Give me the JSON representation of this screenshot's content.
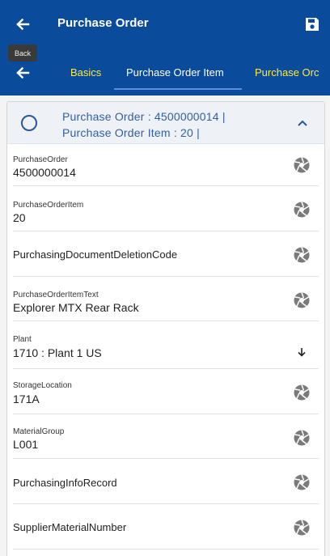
{
  "header": {
    "title": "Purchase Order",
    "back_tooltip": "Back",
    "icons": {
      "back": "arrow-left-icon",
      "save": "save-icon"
    }
  },
  "tabs": [
    {
      "label": "Basics"
    },
    {
      "label": "Purchase Order Item"
    },
    {
      "label": "Purchase Orc"
    }
  ],
  "item": {
    "header_line1": "Purchase Order : 4500000014 |",
    "header_line2": "Purchase Order Item : 20 |",
    "fields": [
      {
        "label": "PurchaseOrder",
        "value": "4500000014",
        "icon": "aperture-icon"
      },
      {
        "label": "PurchaseOrderItem",
        "value": "20",
        "icon": "aperture-icon"
      },
      {
        "label": "PurchasingDocumentDeletionCode",
        "value": "",
        "icon": "aperture-icon"
      },
      {
        "label": "PurchaseOrderItemText",
        "value": "Explorer MTX Rear Rack",
        "icon": "aperture-icon"
      },
      {
        "label": "Plant",
        "value": "1710 : Plant 1 US",
        "icon": "arrow-down-icon"
      },
      {
        "label": "StorageLocation",
        "value": "171A",
        "icon": "aperture-icon"
      },
      {
        "label": "MaterialGroup",
        "value": "L001",
        "icon": "aperture-icon"
      },
      {
        "label": "PurchasingInfoRecord",
        "value": "",
        "icon": "aperture-icon"
      },
      {
        "label": "SupplierMaterialNumber",
        "value": "",
        "icon": "aperture-icon"
      }
    ]
  },
  "colors": {
    "primary": "#0a4b9c",
    "tab_accent": "#ffeb3b",
    "header_text": "#35609e"
  }
}
